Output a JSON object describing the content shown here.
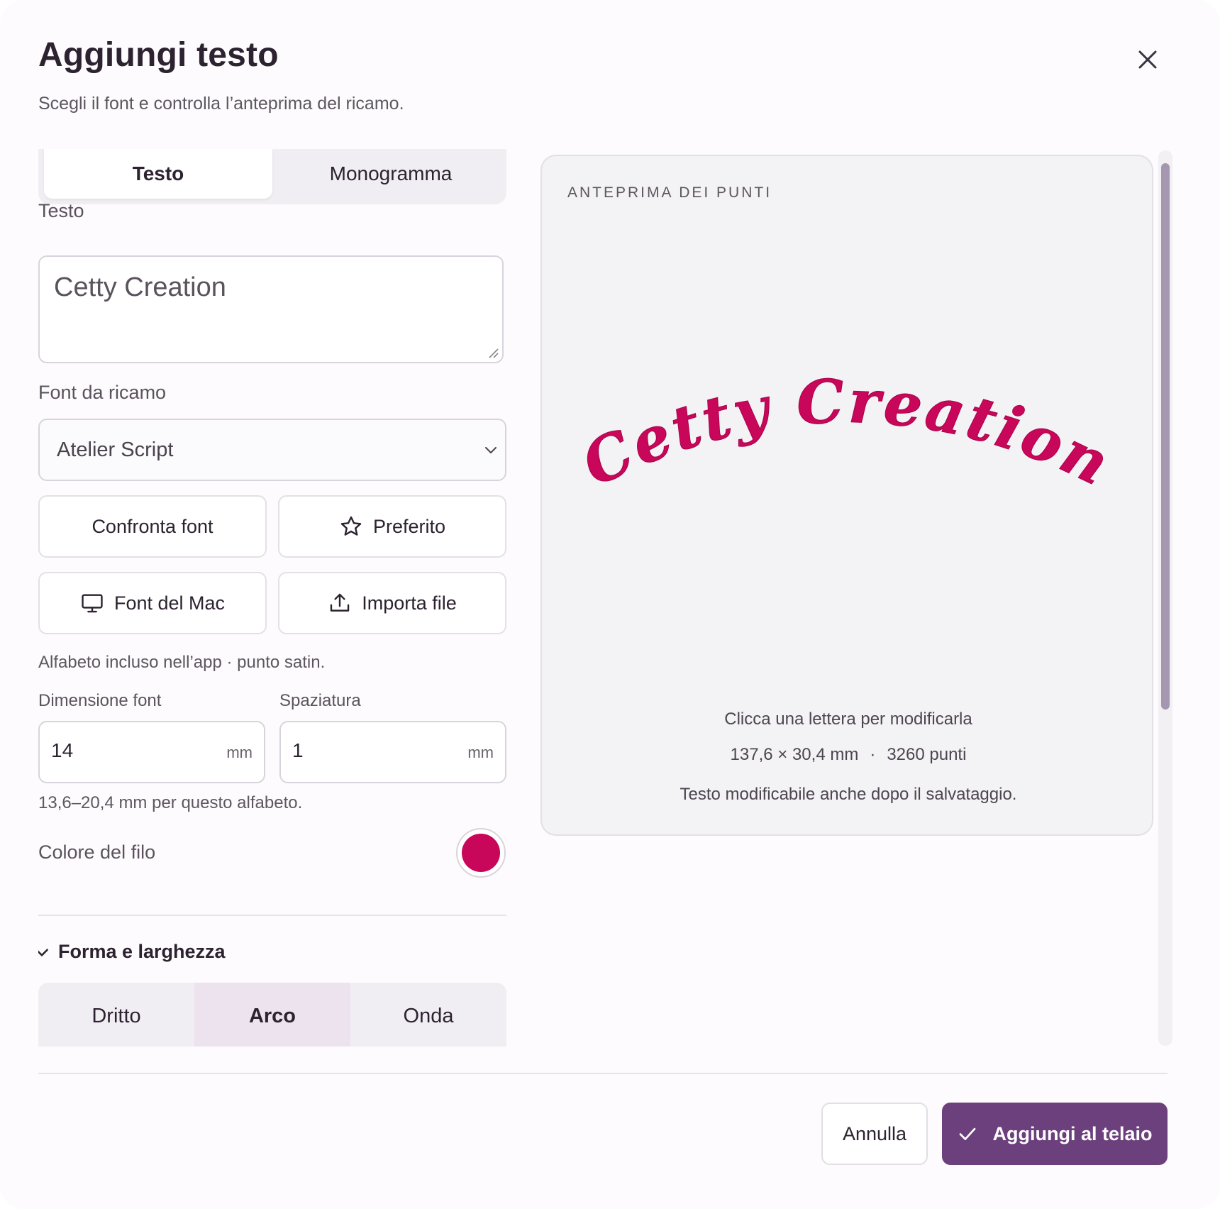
{
  "dialog": {
    "title": "Aggiungi testo",
    "subtitle": "Scegli il font e controlla l’anteprima del ricamo."
  },
  "mode_tabs": [
    {
      "label": "Testo",
      "active": true
    },
    {
      "label": "Monogramma",
      "active": false
    }
  ],
  "text_field": {
    "label": "Testo",
    "value": "Cetty Creation"
  },
  "font": {
    "label": "Font da ricamo",
    "selected": "Atelier Script",
    "compare_label": "Confronta font",
    "favorite_label": "Preferito",
    "mac_fonts_label": "Font del Mac",
    "import_label": "Importa file",
    "hint": "Alfabeto incluso nell’app · punto satin."
  },
  "size": {
    "label": "Dimensione font",
    "value": "14",
    "unit": "mm"
  },
  "spacing": {
    "label": "Spaziatura",
    "value": "1",
    "unit": "mm"
  },
  "size_hint": "13,6–20,4 mm per questo alfabeto.",
  "thread": {
    "label": "Colore del filo",
    "color": "#c8065a"
  },
  "shape_section": {
    "title": "Forma e larghezza",
    "expanded": true,
    "options": [
      {
        "label": "Dritto",
        "active": false
      },
      {
        "label": "Arco",
        "active": true
      },
      {
        "label": "Onda",
        "active": false
      }
    ]
  },
  "preview": {
    "label": "ANTEPRIMA DEI PUNTI",
    "text": "Cetty Creation",
    "hint": "Clicca una lettera per modificarla",
    "dimensions": "137,6 × 30,4 mm",
    "separator": "·",
    "stitches": "3260 punti",
    "note": "Testo modificabile anche dopo il salvataggio."
  },
  "footer": {
    "cancel_label": "Annulla",
    "confirm_label": "Aggiungi al telaio"
  },
  "colors": {
    "accent": "#6c3f7d",
    "thread": "#c8065a"
  }
}
